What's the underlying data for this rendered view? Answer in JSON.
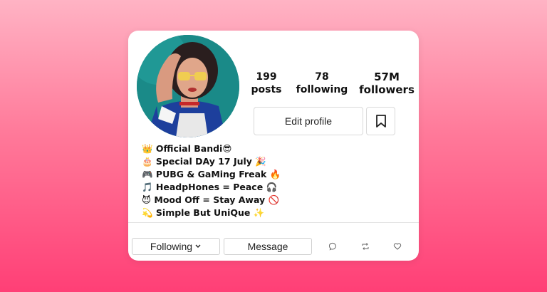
{
  "stats": {
    "posts": {
      "value": "199",
      "label": "posts"
    },
    "following": {
      "value": "78",
      "label": "following"
    },
    "followers": {
      "value": "57M",
      "label": "followers"
    }
  },
  "buttons": {
    "edit_profile": "Edit profile",
    "following": "Following",
    "message": "Message"
  },
  "bio": [
    "👑 Official Bandi😎",
    "🎂 Special DAy 17 July 🎉",
    "🎮 PUBG & GaMing Freak 🔥",
    "🎵 HeadpHones = Peace 🎧",
    "😈 Mood Off = Stay Away 🚫",
    "💫 Simple But UniQue ✨"
  ],
  "icons": {
    "bookmark": "bookmark-icon",
    "chevron": "chevron-down-icon",
    "comment": "comment-icon",
    "repost": "repost-icon",
    "like": "heart-icon"
  },
  "colors": {
    "bg_top": "#ffb3c4",
    "bg_bottom": "#ff3f76",
    "card": "#ffffff"
  }
}
